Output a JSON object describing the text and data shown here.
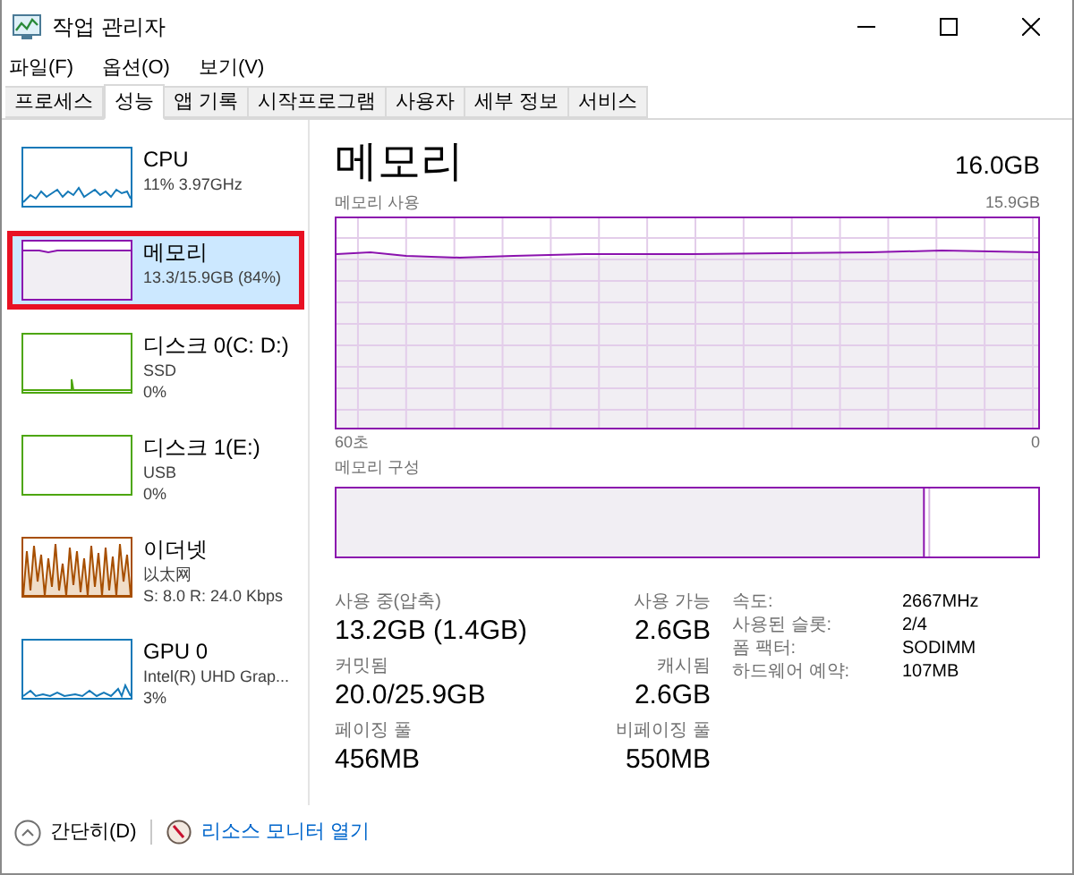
{
  "window": {
    "title": "작업 관리자"
  },
  "menu": [
    "파일(F)",
    "옵션(O)",
    "보기(V)"
  ],
  "tabs": [
    {
      "label": "프로세스",
      "selected": false
    },
    {
      "label": "성능",
      "selected": true
    },
    {
      "label": "앱 기록",
      "selected": false
    },
    {
      "label": "시작프로그램",
      "selected": false
    },
    {
      "label": "사용자",
      "selected": false
    },
    {
      "label": "세부 정보",
      "selected": false
    },
    {
      "label": "서비스",
      "selected": false
    }
  ],
  "sidebar": {
    "items": [
      {
        "kind": "cpu",
        "name": "CPU",
        "lines": [
          "11% 3.97GHz"
        ],
        "color": "#1479b8",
        "selected": false
      },
      {
        "kind": "memory",
        "name": "메모리",
        "lines": [
          "13.3/15.9GB (84%)"
        ],
        "color": "#8b12ae",
        "selected": true
      },
      {
        "kind": "disk",
        "name": "디스크 0(C: D:)",
        "lines": [
          "SSD",
          "0%"
        ],
        "color": "#4da60c",
        "selected": false
      },
      {
        "kind": "disk_idle",
        "name": "디스크 1(E:)",
        "lines": [
          "USB",
          "0%"
        ],
        "color": "#4da60c",
        "selected": false
      },
      {
        "kind": "network",
        "name": "이더넷",
        "lines": [
          "以太网",
          "S: 8.0 R: 24.0 Kbps"
        ],
        "color": "#a74f01",
        "selected": false
      },
      {
        "kind": "gpu",
        "name": "GPU 0",
        "lines": [
          "Intel(R) UHD Grap...",
          "3%"
        ],
        "color": "#1479b8",
        "selected": false
      }
    ]
  },
  "detail": {
    "title": "메모리",
    "total": "16.0GB",
    "usage_label": "메모리 사용",
    "usage_max": "15.9GB",
    "time_start": "60초",
    "time_end": "0",
    "composition_label": "메모리 구성",
    "stats": [
      {
        "label": "사용 중(압축)",
        "value": "13.2GB (1.4GB)"
      },
      {
        "label": "사용 가능",
        "value": "2.6GB"
      },
      {
        "label": "커밋됨",
        "value": "20.0/25.9GB"
      },
      {
        "label": "캐시됨",
        "value": "2.6GB"
      },
      {
        "label": "페이징 풀",
        "value": "456MB"
      },
      {
        "label": "비페이징 풀",
        "value": "550MB"
      }
    ],
    "properties": [
      {
        "key": "속도:",
        "value": "2667MHz"
      },
      {
        "key": "사용된 슬롯:",
        "value": "2/4"
      },
      {
        "key": "폼 팩터:",
        "value": "SODIMM"
      },
      {
        "key": "하드웨어 예약:",
        "value": "107MB"
      }
    ]
  },
  "footer": {
    "collapse": "간단히(D)",
    "link": "리소스 모니터 열기"
  }
}
